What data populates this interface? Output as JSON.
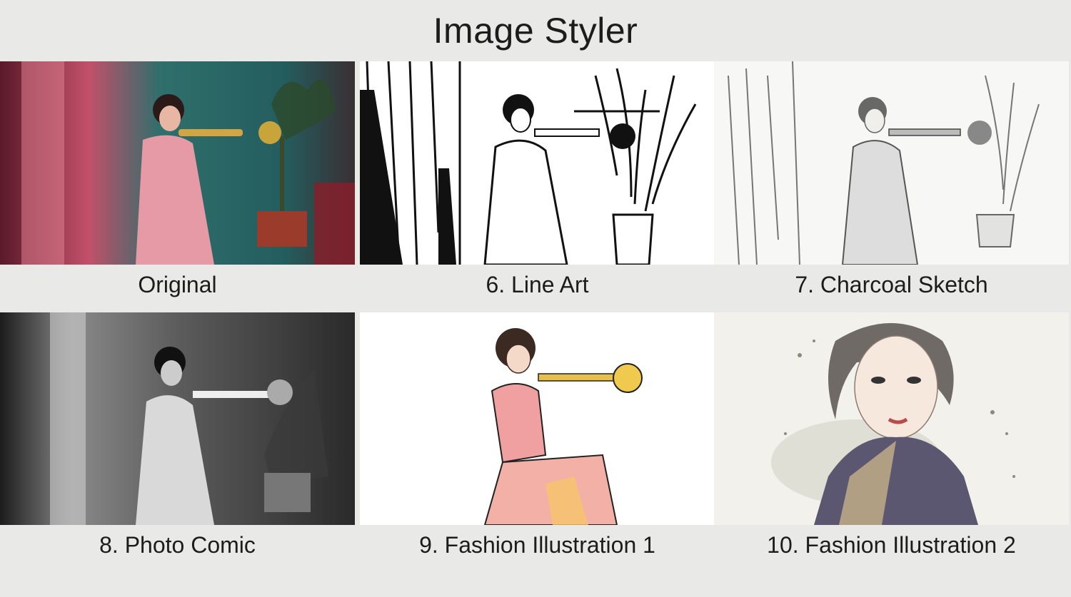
{
  "app": {
    "title": "Image Styler"
  },
  "tiles": [
    {
      "label": "Original"
    },
    {
      "label": "6. Line Art"
    },
    {
      "label": "7. Charcoal Sketch"
    },
    {
      "label": "8. Photo Comic"
    },
    {
      "label": "9. Fashion Illustration 1"
    },
    {
      "label": "10. Fashion Illustration 2"
    }
  ],
  "colors": {
    "background": "#e9eae8",
    "original_teal": "#2e6f6c",
    "original_pink": "#d9738a",
    "trumpet_gold": "#c9a43a"
  }
}
